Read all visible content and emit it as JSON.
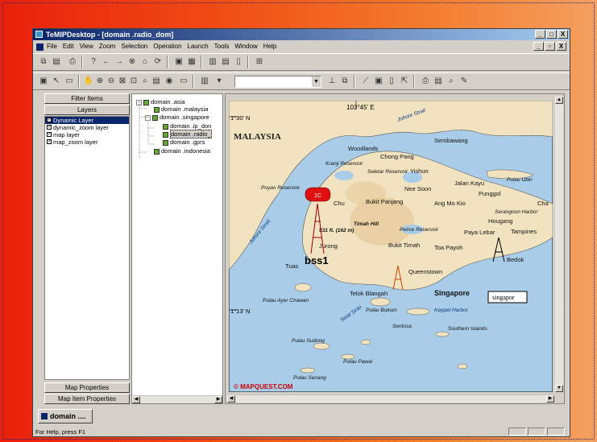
{
  "window": {
    "title": "TeMIPDesktop - [domain .radio_dom]",
    "controls": [
      "_",
      "□",
      "X"
    ],
    "mdi_controls": [
      "_",
      "▫",
      "X"
    ]
  },
  "menu": [
    "File",
    "Edit",
    "View",
    "Zoom",
    "Selection",
    "Operation",
    "Launch",
    "Tools",
    "Window",
    "Help"
  ],
  "left_panel": {
    "filter_label": "Filter Items",
    "layers_label": "Layers",
    "layers": [
      {
        "name": "Dynamic Layer",
        "checked": true,
        "selected": true
      },
      {
        "name": "dynamic_zoom layer",
        "checked": true,
        "selected": false
      },
      {
        "name": "map layer",
        "checked": true,
        "selected": false
      },
      {
        "name": "map_zoom layer",
        "checked": true,
        "selected": false
      }
    ],
    "map_properties_label": "Map Properties",
    "map_item_properties_label": "Map Item Properties"
  },
  "tree": [
    {
      "label": "domain .asia",
      "expand": "-",
      "level": 0,
      "selected": false
    },
    {
      "label": "domain .malaysia",
      "expand": "",
      "level": 1,
      "selected": false
    },
    {
      "label": "domain .singapore",
      "expand": "-",
      "level": 1,
      "selected": false
    },
    {
      "label": "domain .ip_don",
      "expand": "",
      "level": 2,
      "selected": false
    },
    {
      "label": "domain .radio_",
      "expand": "",
      "level": 2,
      "selected": true
    },
    {
      "label": "domain .gprs",
      "expand": "",
      "level": 2,
      "selected": false
    },
    {
      "label": "domain .indonesia",
      "expand": "",
      "level": 1,
      "selected": false
    }
  ],
  "map": {
    "lon_label": "103°45' E",
    "lat_top": "1°30' N",
    "lat_bottom": "1°13' N",
    "country": "MALAYSIA",
    "straits": [
      "Johore Strait",
      "Johore Strait"
    ],
    "places": [
      "Woodlands",
      "Sembawang",
      "Chong Pang",
      "Yishun",
      "Kranji Reservoir",
      "Seletar Reservoir",
      "Pulau Ubin",
      "Poyan Reservoir",
      "Nee Soon",
      "Jalan Kayu",
      "Punggol",
      "Chu",
      "Bukit Panjang",
      "Ang Mo Kio",
      "Serangoon Harbor",
      "Cha",
      "Timah Hill",
      "531 ft. (162 m)",
      "Peirce Reservoir",
      "Hougang",
      "Paya Lebar",
      "Tampines",
      "Jurong",
      "Bukit Timah",
      "Toa Payoh",
      "Bedok",
      "Tuas",
      "Queenstown",
      "Telok Blangah",
      "Singapore",
      "Pulau Ayer Chawan",
      "Pulau Bukum",
      "Sentosa",
      "Keppel Harbor",
      "Selat Sinki",
      "Southern Islands",
      "Pulau Sudong",
      "Pulau Pawai",
      "Pulau Senang"
    ],
    "alarm_label": "1C",
    "site_label": "bss1",
    "site_box": "singapor",
    "copyright": "© MAPQUEST.COM"
  },
  "doc_tab": "domain ....",
  "status": "For Help, press F1",
  "colors": {
    "water": "#a9cde8",
    "land": "#f2e3c0",
    "alarm": "#e01010"
  }
}
